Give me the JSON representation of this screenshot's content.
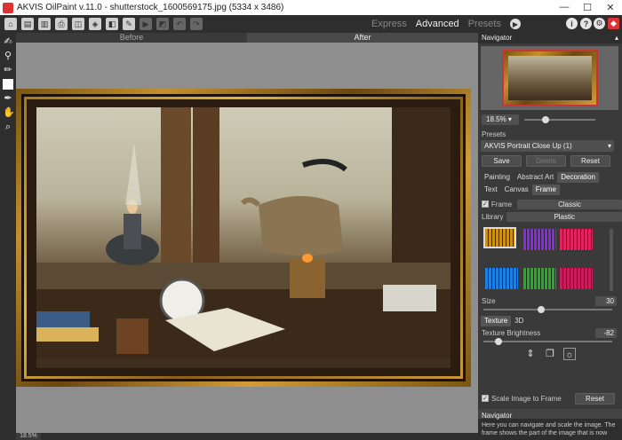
{
  "window": {
    "title": "AKVIS OilPaint v.11.0 - shutterstock_1600569175.jpg (5334 x 3486)",
    "minimize": "—",
    "maximize": "☐",
    "close": "✕"
  },
  "modes": {
    "express": "Express",
    "advanced": "Advanced",
    "presets": "Presets"
  },
  "canvas": {
    "before_tab": "Before",
    "after_tab": "After",
    "zoom_status": "18.5%"
  },
  "navigator": {
    "title": "Navigator",
    "zoom_value": "18.5%",
    "zoom_slider_level": 0.3
  },
  "presets": {
    "label": "Presets",
    "selected": "AKVIS Portrait Close Up (1)",
    "save": "Save",
    "delete": "Delete",
    "reset": "Reset"
  },
  "main_tabs": [
    "Painting",
    "Abstract Art",
    "Decoration"
  ],
  "sub_tabs": [
    "Text",
    "Canvas",
    "Frame"
  ],
  "frame": {
    "checkbox_label": "Frame",
    "frame_type": "Classic",
    "library_label": "Library",
    "library_value": "Plastic",
    "swatch_colors": [
      "#c9921f",
      "#8a2be2",
      "#e0245e",
      "#1e7fe0",
      "#1fb020",
      "#c81e5a"
    ],
    "size_label": "Size",
    "size_value": "30",
    "size_slider_level": 0.45
  },
  "texture_tabs": [
    "Texture",
    "3D"
  ],
  "texture": {
    "brightness_label": "Texture Brightness",
    "brightness_value": "-82",
    "brightness_slider_level": 0.12
  },
  "scale_image": {
    "label": "Scale Image to Frame",
    "reset": "Reset"
  },
  "help": {
    "title": "Navigator",
    "text": "Here you can navigate and scale the image. The frame shows the part of the image that is now"
  }
}
